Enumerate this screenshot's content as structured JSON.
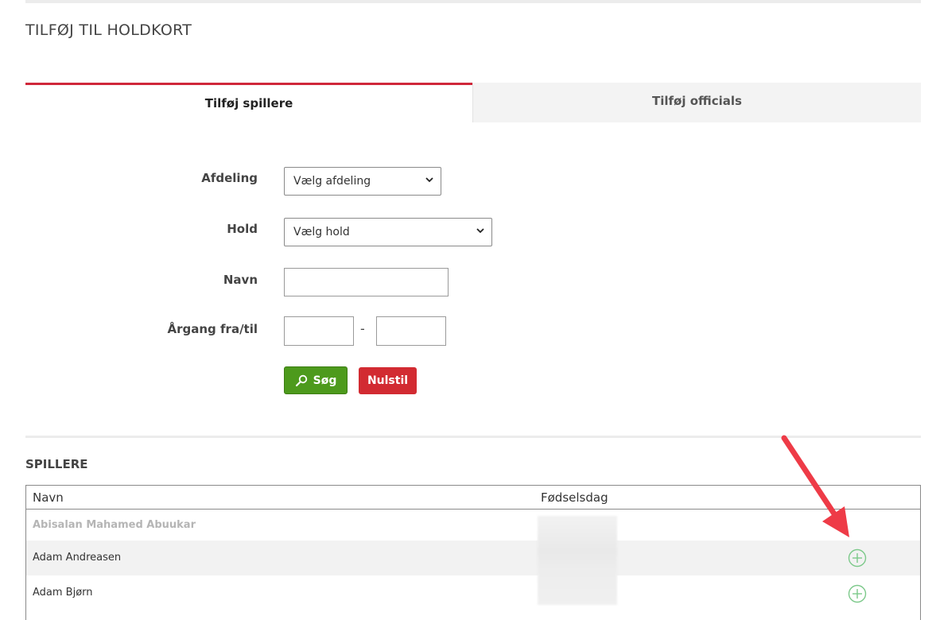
{
  "page": {
    "title": "TILFØJ TIL HOLDKORT"
  },
  "tabs": [
    {
      "label": "Tilføj spillere",
      "active": true
    },
    {
      "label": "Tilføj officials",
      "active": false
    }
  ],
  "form": {
    "department": {
      "label": "Afdeling",
      "selected": "Vælg afdeling"
    },
    "team": {
      "label": "Hold",
      "selected": "Vælg hold"
    },
    "name": {
      "label": "Navn",
      "value": ""
    },
    "year": {
      "label": "Årgang fra/til",
      "from": "",
      "to": "",
      "separator": "-"
    },
    "search_label": "Søg",
    "reset_label": "Nulstil"
  },
  "players": {
    "title": "SPILLERE",
    "columns": [
      "Navn",
      "Fødselsdag"
    ],
    "rows": [
      {
        "name": "Abisalan Mahamed Abuukar",
        "birthday": "",
        "disabled": true
      },
      {
        "name": "Adam Andreasen",
        "birthday": "",
        "disabled": false
      },
      {
        "name": "Adam Bjørn",
        "birthday": "",
        "disabled": false
      }
    ]
  },
  "colors": {
    "accent": "#d0273a",
    "search_button": "#4d9a1c",
    "reset_button": "#d22b32",
    "add_icon": "#7cc98a",
    "annotation_arrow": "#ee3b47"
  },
  "icons": {
    "search": "magnifier-icon",
    "add": "plus-circle-icon"
  }
}
